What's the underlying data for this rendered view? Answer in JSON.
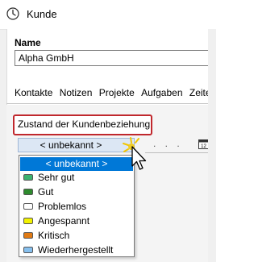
{
  "window": {
    "title": "Kunde"
  },
  "form": {
    "name_label": "Name",
    "name_value": "Alpha GmbH"
  },
  "tabs": [
    {
      "label": "Kontakte"
    },
    {
      "label": "Notizen"
    },
    {
      "label": "Projekte"
    },
    {
      "label": "Aufgaben"
    },
    {
      "label": "Zeite"
    }
  ],
  "relationship": {
    "label": "Zustand der Kundenbeziehung",
    "selected_value": "< unbekannt >",
    "date_placeholder": ". . ."
  },
  "dropdown": {
    "options": [
      {
        "label": "< unbekannt >",
        "color": "",
        "selected": true
      },
      {
        "label": "Sehr gut",
        "color": "#3cb371",
        "selected": false
      },
      {
        "label": "Gut",
        "color": "#2e8b2e",
        "selected": false
      },
      {
        "label": "Problemlos",
        "color": "#ffffff",
        "selected": false
      },
      {
        "label": "Angespannt",
        "color": "#f2f200",
        "selected": false
      },
      {
        "label": "Kritisch",
        "color": "#e07a14",
        "selected": false
      },
      {
        "label": "Wiederhergestellt",
        "color": "#87c0ee",
        "selected": false
      }
    ]
  },
  "icons": {
    "app": "window-app-icon",
    "calendar": "calendar-icon",
    "cursor": "mouse-pointer-icon"
  }
}
